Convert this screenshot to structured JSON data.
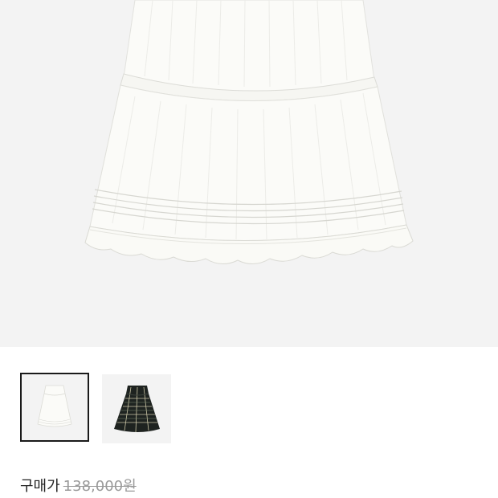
{
  "product": {
    "main_image": {
      "name": "white-tiered-skirt",
      "background": "#f3f3f3"
    },
    "thumbnails": [
      {
        "name": "white-skirt-thumbnail",
        "selected": true
      },
      {
        "name": "plaid-skirt-thumbnail",
        "selected": false
      }
    ],
    "price_label": "구매가",
    "original_price": "138,000원"
  },
  "colors": {
    "skirt_white": "#fbfbf8",
    "plaid_dark": "#1e2320",
    "plaid_line": "#c9c4a4",
    "selected_border": "#1a1a1a",
    "strikethrough_text": "#9a9a9a"
  }
}
